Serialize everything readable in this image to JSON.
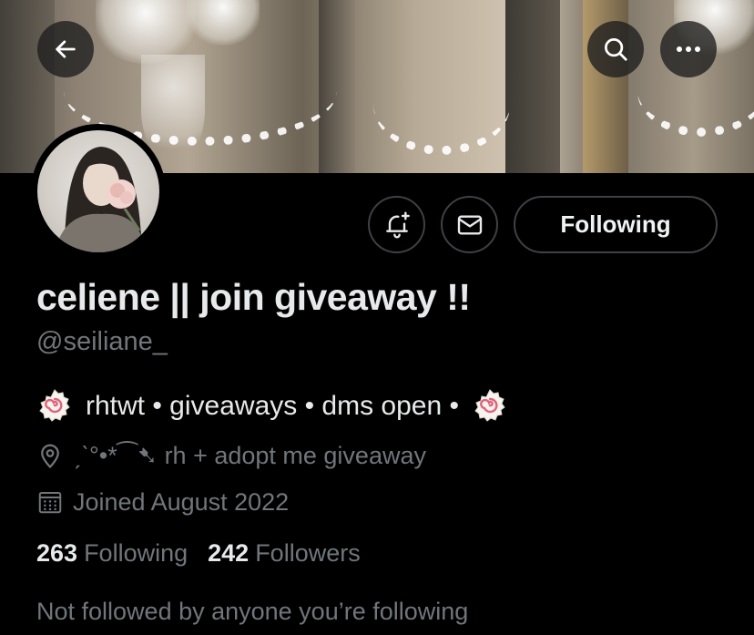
{
  "header": {
    "back_icon": "arrow-left-icon",
    "search_icon": "search-icon",
    "more_icon": "more-horizontal-icon"
  },
  "profile": {
    "display_name": "celiene || join giveaway !!",
    "handle": "@seiliane_",
    "bio": {
      "emoji_left": "fishcake-emoji",
      "text": "rhtwt • giveaways • dms open •",
      "emoji_right": "fishcake-emoji"
    },
    "location": "ˏˋ°•*⁀➷ rh + adopt me giveaway",
    "joined": "Joined August 2022",
    "following_count": "263",
    "following_label": "Following",
    "followers_count": "242",
    "followers_label": "Followers",
    "not_followed_text": "Not followed by anyone you’re following"
  },
  "actions": {
    "notify_icon": "bell-plus-icon",
    "message_icon": "envelope-icon",
    "follow_button_label": "Following"
  },
  "colors": {
    "background": "#000000",
    "primary_text": "#e7e9ea",
    "secondary_text": "#71767b",
    "button_border": "#3e4144"
  }
}
